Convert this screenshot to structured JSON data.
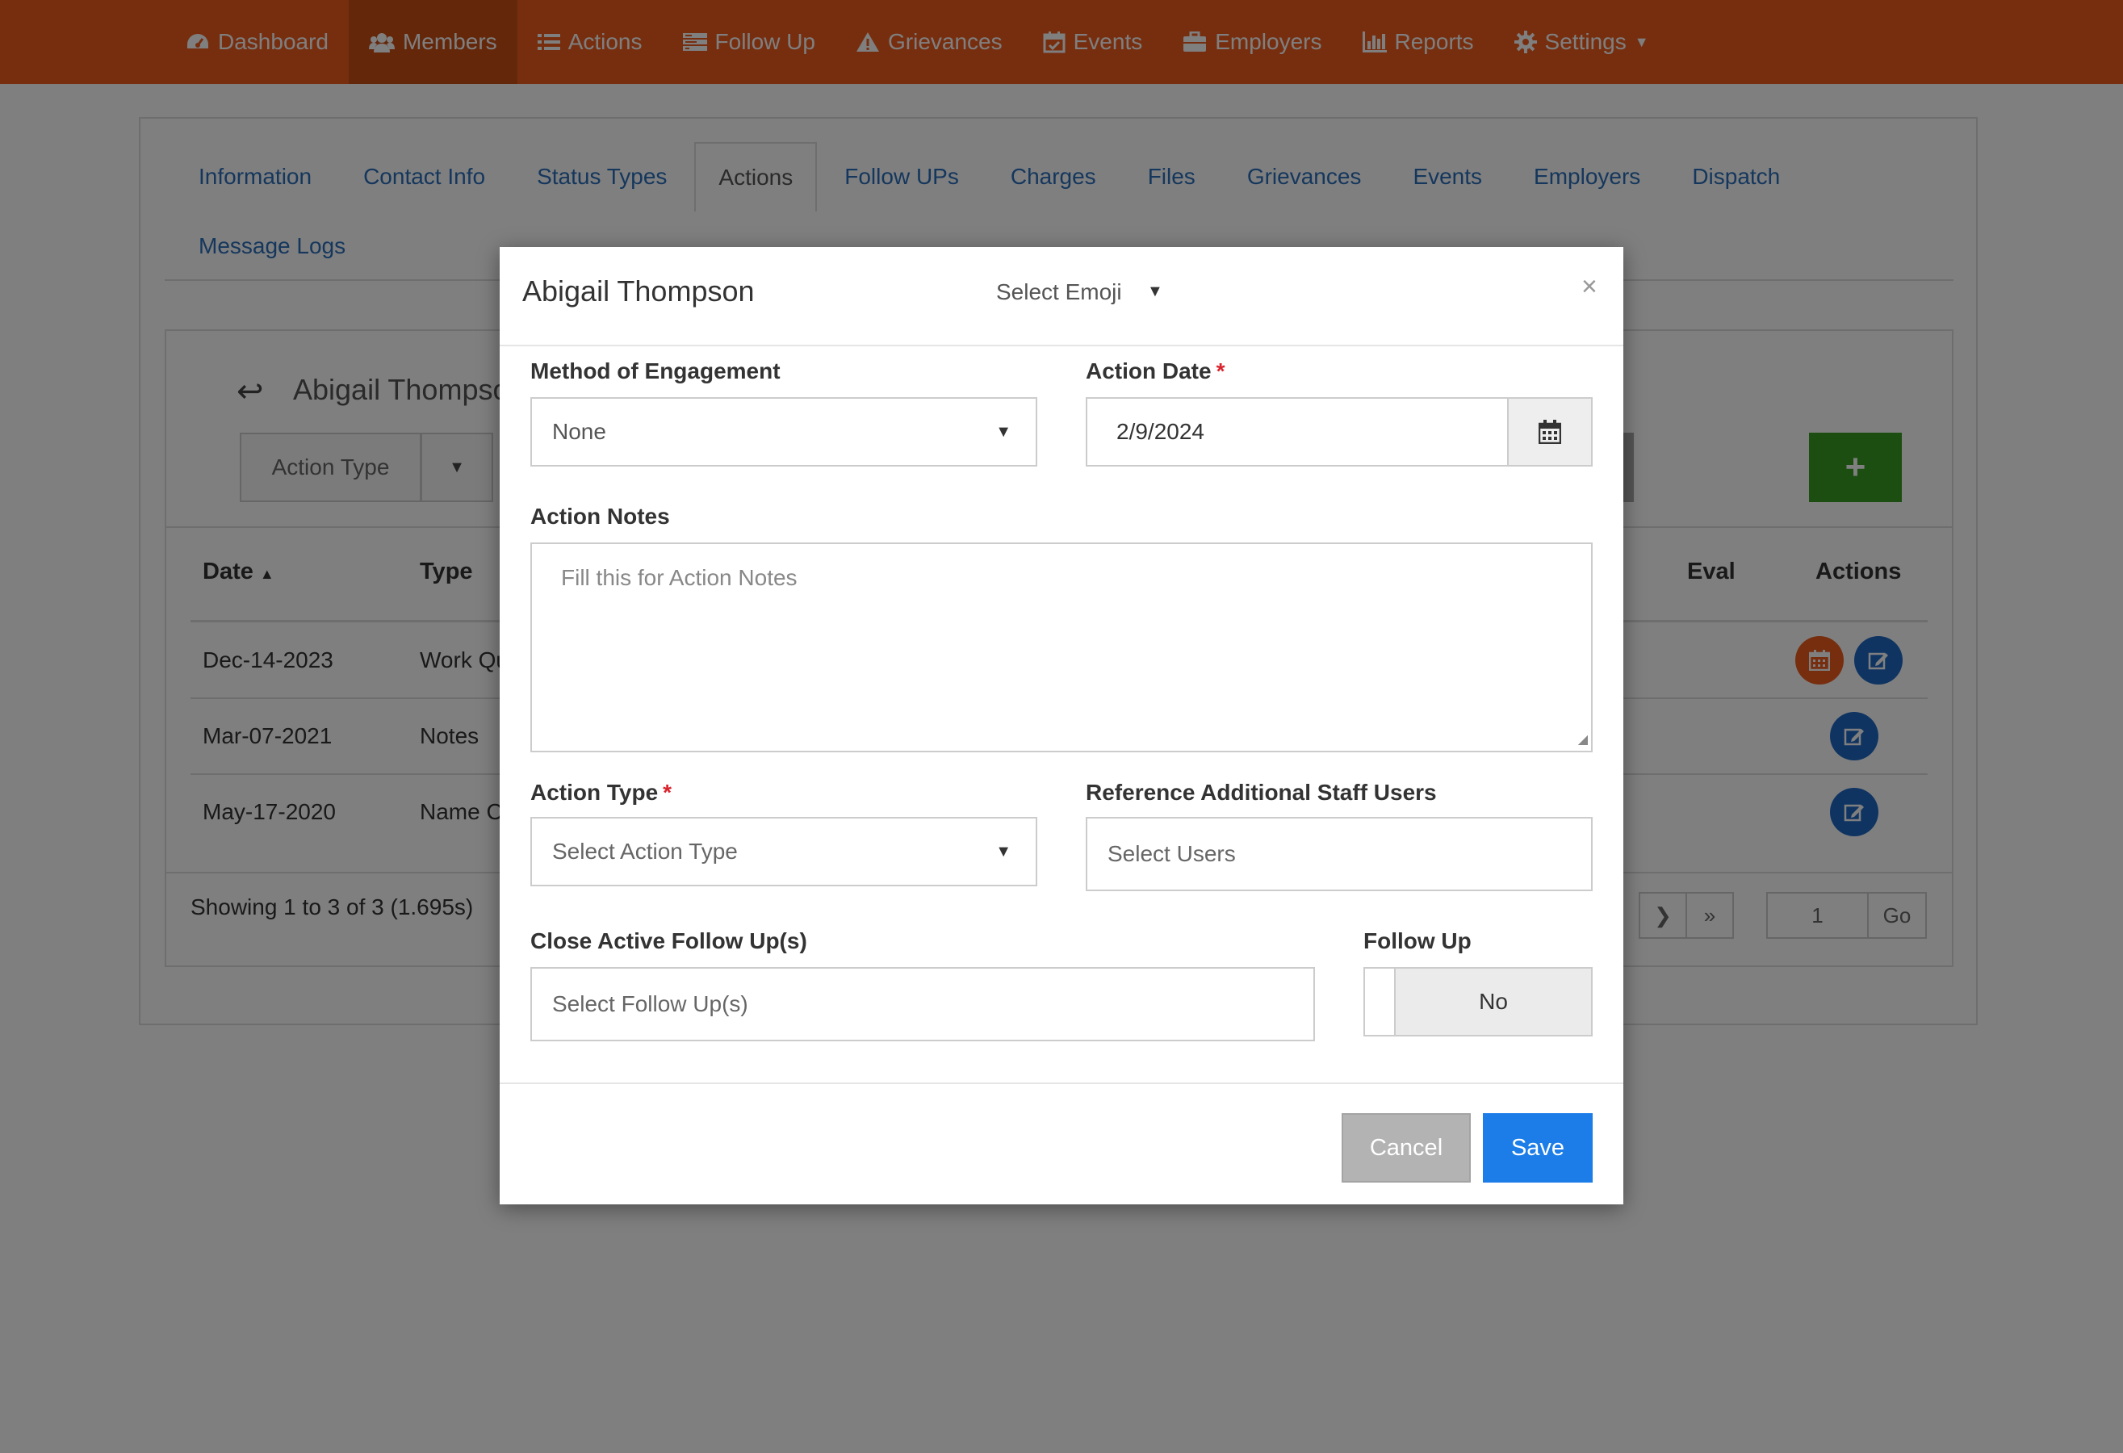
{
  "navbar": {
    "brand_color": "#ee5d1f",
    "items": [
      {
        "label": "Dashboard",
        "icon": "dashboard-icon"
      },
      {
        "label": "Members",
        "icon": "users-icon",
        "active": true
      },
      {
        "label": "Actions",
        "icon": "list-icon"
      },
      {
        "label": "Follow Up",
        "icon": "tasks-icon"
      },
      {
        "label": "Grievances",
        "icon": "warning-icon"
      },
      {
        "label": "Events",
        "icon": "calendar-check-icon"
      },
      {
        "label": "Employers",
        "icon": "briefcase-icon"
      },
      {
        "label": "Reports",
        "icon": "bar-chart-icon"
      },
      {
        "label": "Settings",
        "icon": "gear-icon"
      }
    ]
  },
  "tabs": {
    "row1": [
      "Information",
      "Contact Info",
      "Status Types",
      "Actions",
      "Follow UPs",
      "Charges",
      "Files",
      "Grievances",
      "Events",
      "Employers",
      "Dispatch"
    ],
    "row2": [
      "Message Logs"
    ],
    "active": "Actions"
  },
  "member_panel": {
    "title": "Abigail Thompso",
    "action_type_button": "Action Type",
    "add_button": "+"
  },
  "table": {
    "headers": {
      "date": "Date",
      "type": "Type",
      "eval": "Eval",
      "actions": "Actions"
    },
    "rows": [
      {
        "date": "Dec-14-2023",
        "type": "Work Qu"
      },
      {
        "date": "Mar-07-2021",
        "type": "Notes"
      },
      {
        "date": "May-17-2020",
        "type": "Name C"
      }
    ],
    "showing": "Showing 1 to 3 of 3 (1.695s)",
    "page_input": "1",
    "go_label": "Go"
  },
  "modal": {
    "title": "Abigail Thompson",
    "emoji_select": "Select Emoji",
    "close": "×",
    "method_of_engagement": {
      "label": "Method of Engagement",
      "value": "None"
    },
    "action_date": {
      "label": "Action Date",
      "required": "*",
      "value": "2/9/2024"
    },
    "action_notes": {
      "label": "Action Notes",
      "placeholder": "Fill this for Action Notes"
    },
    "action_type": {
      "label": "Action Type",
      "required": "*",
      "placeholder": "Select Action Type"
    },
    "reference_users": {
      "label": "Reference Additional Staff Users",
      "placeholder": "Select Users"
    },
    "close_follow_ups": {
      "label": "Close Active Follow Up(s)",
      "placeholder": "Select Follow Up(s)"
    },
    "follow_up": {
      "label": "Follow Up",
      "value": "No"
    },
    "cancel_label": "Cancel",
    "save_label": "Save"
  }
}
